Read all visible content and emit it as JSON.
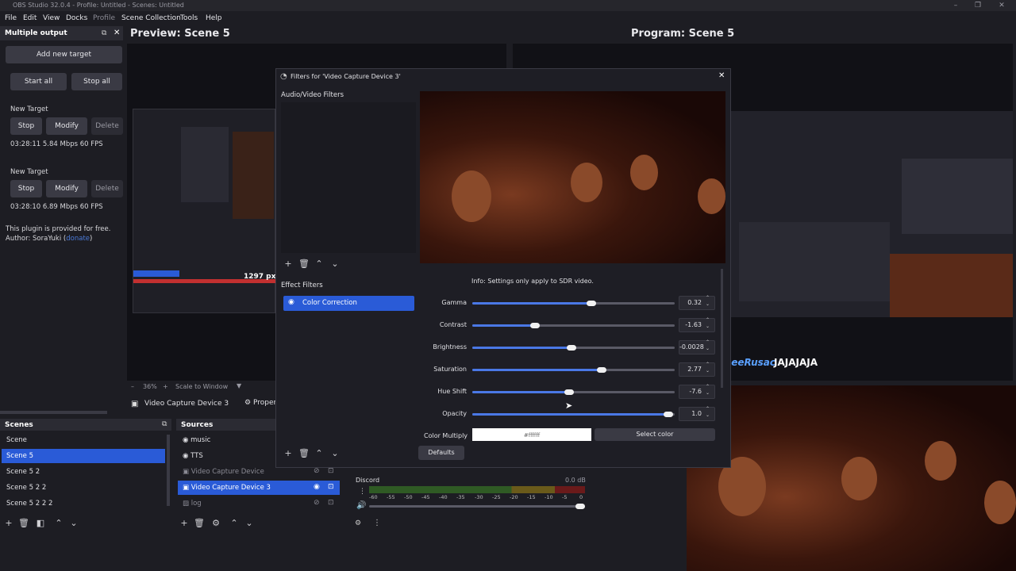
{
  "app": {
    "title": "OBS Studio 32.0.4 - Profile: Untitled - Scenes: Untitled"
  },
  "menu": [
    "File",
    "Edit",
    "View",
    "Docks",
    "Profile",
    "Scene Collection",
    "Tools",
    "Help"
  ],
  "output_dock": {
    "title": "Multiple output",
    "add_target": "Add new target",
    "start_all": "Start all",
    "stop_all": "Stop all",
    "targets": [
      {
        "name": "New Target",
        "stop": "Stop",
        "modify": "Modify",
        "delete": "Delete",
        "stats": "03:28:11  5.84 Mbps  60 FPS"
      },
      {
        "name": "New Target",
        "stop": "Stop",
        "modify": "Modify",
        "delete": "Delete",
        "stats": "03:28:10  6.89 Mbps  60 FPS"
      }
    ],
    "note": "This plugin is provided for free.",
    "author_pre": "Author: SoraYuki (",
    "author_link": "donate",
    "author_post": ")"
  },
  "preview": {
    "title": "Preview: Scene 5",
    "zoom": "36%",
    "scale": "Scale to Window",
    "source": "Video Capture Device 3",
    "props": "Proper",
    "px_label": "1297 px"
  },
  "program": {
    "title": "Program: Scene 5",
    "overlay_name": "JoneeRusac",
    "overlay_text": "JAJAJAJA"
  },
  "scenes": {
    "title": "Scenes",
    "items": [
      "Scene",
      "Scene 5",
      "Scene 5 2",
      "Scene 5 2 2",
      "Scene 5 2 2 2"
    ],
    "selected": 1
  },
  "sources": {
    "title": "Sources",
    "items": [
      {
        "name": "music",
        "icon": "speaker-icon"
      },
      {
        "name": "TTS",
        "icon": "speaker-icon"
      },
      {
        "name": "Video Capture Device",
        "icon": "camera-icon"
      },
      {
        "name": "Video Capture Device 3",
        "icon": "camera-icon"
      },
      {
        "name": "log",
        "icon": "image-icon"
      }
    ]
  },
  "mixer": {
    "channel": "Discord",
    "db": "0.0 dB",
    "ticks": [
      "-60",
      "-55",
      "-50",
      "-45",
      "-40",
      "-35",
      "-30",
      "-25",
      "-20",
      "-15",
      "-10",
      "-5",
      "0"
    ]
  },
  "dialog": {
    "title": "Filters for 'Video Capture Device 3'",
    "av_label": "Audio/Video Filters",
    "effect_label": "Effect Filters",
    "filter": "Color Correction",
    "info": "Info: Settings only apply to SDR video.",
    "defaults": "Defaults",
    "settings": [
      {
        "label": "Gamma",
        "value": "0.32",
        "level": 0.59
      },
      {
        "label": "Contrast",
        "value": "-1.63",
        "level": 0.31
      },
      {
        "label": "Brightness",
        "value": "-0.0028",
        "level": 0.49
      },
      {
        "label": "Saturation",
        "value": "2.77",
        "level": 0.64
      },
      {
        "label": "Hue Shift",
        "value": "-7.6",
        "level": 0.48
      },
      {
        "label": "Opacity",
        "value": "1.0",
        "level": 0.97
      }
    ],
    "color_label": "Color Multiply",
    "color_value": "#ffffff",
    "select_color": "Select color"
  },
  "colors": {
    "accent": "#2a5bd7",
    "bg": "#1d1d23"
  }
}
